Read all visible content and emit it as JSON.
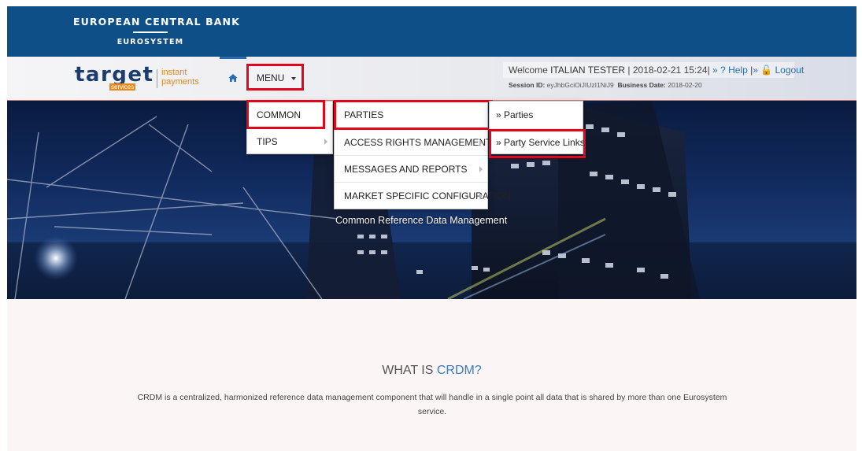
{
  "header": {
    "org_title": "EUROPEAN CENTRAL BANK",
    "org_subtitle": "EUROSYSTEM"
  },
  "brand": {
    "word": "target",
    "services": "services",
    "line1": "instant",
    "line2": "payments"
  },
  "nav": {
    "home_icon": "home-icon",
    "menu_label": "MENU",
    "welcome_prefix": "Welcome ",
    "user_name": "ITALIAN TESTER",
    "datetime": " | 2018-02-21 15:24| ",
    "help_label": "» ? Help",
    "logout_label": "» 🔓 Logout",
    "session_label": "Session ID:",
    "session_id": "eyJhbGciOiJIUzI1NiJ9",
    "business_date_label": "Business Date:",
    "business_date": "2018-02-20"
  },
  "menu": {
    "level1": [
      {
        "label": "COMMON"
      },
      {
        "label": "TIPS"
      }
    ],
    "level2": [
      {
        "label": "PARTIES"
      },
      {
        "label": "ACCESS RIGHTS MANAGEMENT"
      },
      {
        "label": "MESSAGES AND REPORTS"
      },
      {
        "label": "MARKET SPECIFIC CONFIGURATION"
      }
    ],
    "level3": [
      {
        "label": "» Parties"
      },
      {
        "label": "» Party Service Links"
      }
    ]
  },
  "hero": {
    "caption": "Common Reference Data Management"
  },
  "content": {
    "title_prefix": "WHAT IS ",
    "title_accent": "CRDM?",
    "body": "CRDM is a centralized, harmonized reference data management component that will handle in a single point all data that is shared by more than one Eurosystem service."
  },
  "colors": {
    "header_bg": "#0d4f86",
    "accent_red": "#e2061b",
    "brand_orange": "#e8891d",
    "link_blue": "#2a6cb3"
  }
}
